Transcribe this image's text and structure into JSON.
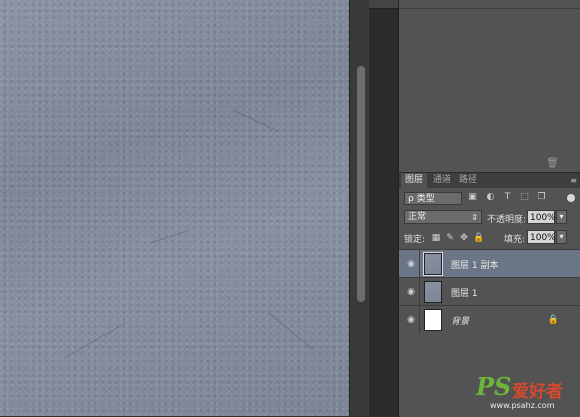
{
  "panel": {
    "tabs": [
      {
        "label": "图层",
        "active": true
      },
      {
        "label": "通道",
        "active": false
      },
      {
        "label": "路径",
        "active": false
      }
    ],
    "filter": {
      "kind_label": "ρ 类型",
      "icons": [
        "image-filter-icon",
        "adjustment-filter-icon",
        "type-filter-icon",
        "shape-filter-icon",
        "smart-object-filter-icon"
      ]
    },
    "blend_mode": "正常",
    "opacity_label": "不透明度:",
    "opacity_value": "100%",
    "lock_label": "锁定:",
    "fill_label": "填充:",
    "fill_value": "100%"
  },
  "layers": [
    {
      "name": "图层 1 副本",
      "selected": true,
      "thumb": "stone"
    },
    {
      "name": "图层 1",
      "selected": false,
      "thumb": "stone"
    },
    {
      "name": "背景",
      "selected": false,
      "thumb": "white",
      "locked": true
    }
  ],
  "watermark": {
    "logo": "PS",
    "text": "爱好者",
    "url": "www.psahz.com"
  }
}
